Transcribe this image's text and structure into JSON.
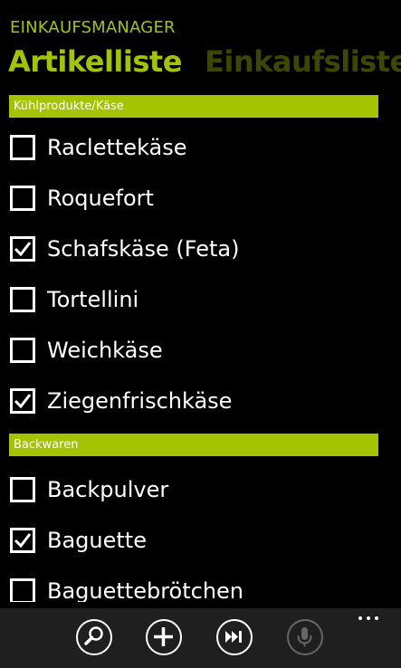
{
  "app": {
    "title": "EINKAUFSMANAGER"
  },
  "pivot": {
    "tabs": [
      {
        "label": "Artikelliste",
        "active": true
      },
      {
        "label": "Einkaufsliste",
        "active": false
      }
    ]
  },
  "groups": [
    {
      "header": "Kühlprodukte/Käse",
      "items": [
        {
          "label": "Raclettekäse",
          "checked": false
        },
        {
          "label": "Roquefort",
          "checked": false
        },
        {
          "label": "Schafskäse (Feta)",
          "checked": true
        },
        {
          "label": "Tortellini",
          "checked": false
        },
        {
          "label": "Weichkäse",
          "checked": false
        },
        {
          "label": "Ziegenfrischkäse",
          "checked": true
        }
      ]
    },
    {
      "header": "Backwaren",
      "items": [
        {
          "label": "Backpulver",
          "checked": false
        },
        {
          "label": "Baguette",
          "checked": true
        },
        {
          "label": "Baguettebrötchen",
          "checked": false
        }
      ]
    }
  ],
  "app_bar": {
    "buttons": [
      {
        "icon": "search-icon",
        "enabled": true
      },
      {
        "icon": "add-icon",
        "enabled": true
      },
      {
        "icon": "next-icon",
        "enabled": true
      },
      {
        "icon": "microphone-icon",
        "enabled": false
      }
    ],
    "more_icon": "ellipsis-icon"
  },
  "colors": {
    "accent": "#a4c400",
    "inactive_tab": "#3e4700",
    "background": "#000000",
    "app_bar": "#1f1f1f",
    "disabled": "#666666"
  }
}
